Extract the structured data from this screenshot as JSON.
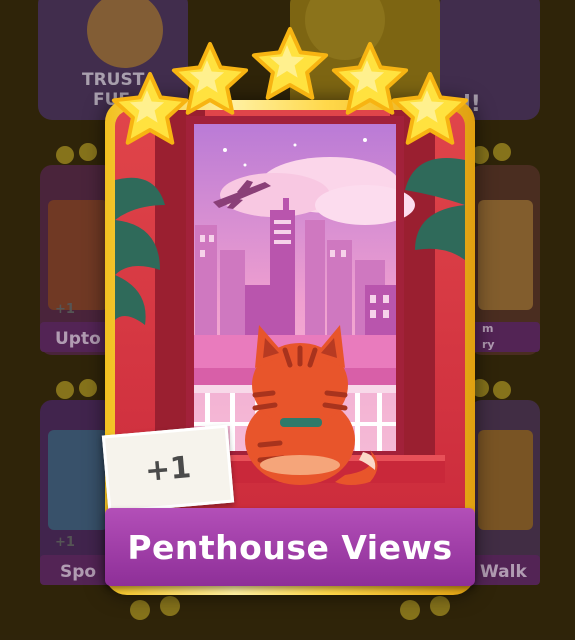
{
  "card": {
    "name": "Penthouse Views",
    "bonus_tag": "+1",
    "stars": 5,
    "max_stars": 5
  },
  "background": {
    "fragments": [
      "TRUST",
      "FUF",
      "d!",
      "+1",
      "Upto",
      "+1",
      "Spo",
      "Walk",
      "m",
      "ry"
    ]
  },
  "colors": {
    "banner": "#9c3aa6",
    "frame_gold": "#f5c531",
    "star": "#ffe23f",
    "window_sky": "#e98fc5",
    "cat": "#e8552b"
  },
  "icons": [
    "star-icon",
    "cat-illustration",
    "airplane-icon",
    "plant-icon"
  ]
}
